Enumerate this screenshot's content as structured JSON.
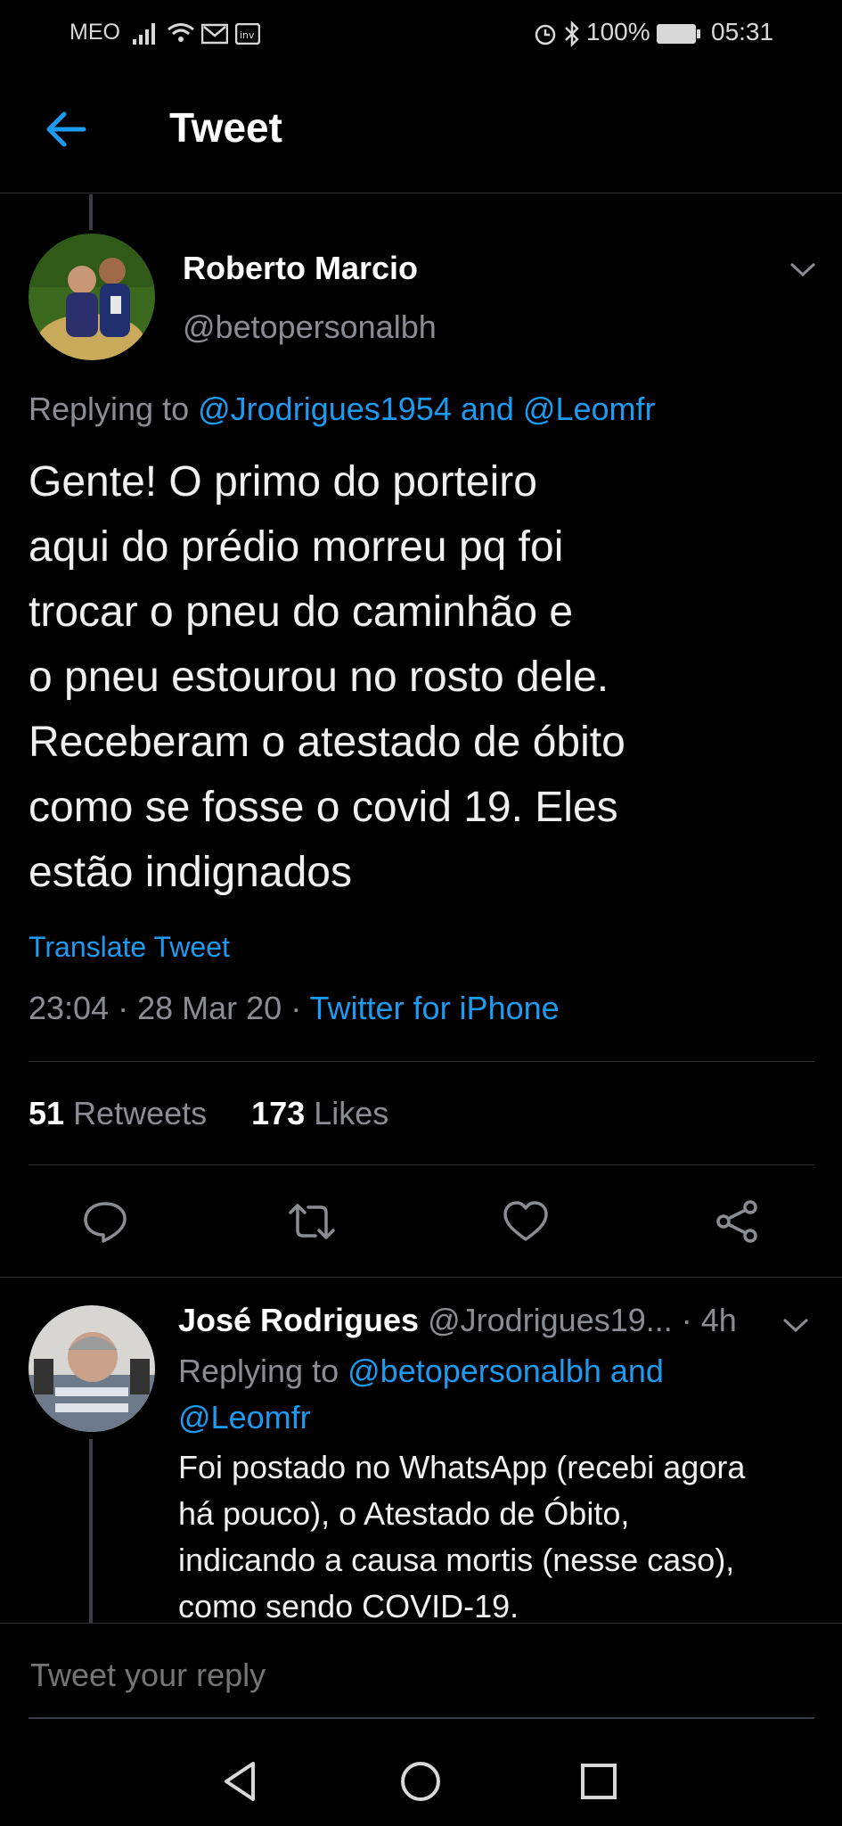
{
  "status_bar": {
    "carrier": "MEO",
    "battery": "100%",
    "time": "05:31"
  },
  "header": {
    "title": "Tweet"
  },
  "tweet": {
    "author_name": "Roberto Marcio",
    "author_handle": "@betopersonalbh",
    "replying_prefix": "Replying to",
    "replying_to": "@Jrodrigues1954 and @Leomfr",
    "text_lines": [
      "Gente! O primo do porteiro",
      "aqui do prédio morreu pq foi",
      "trocar o pneu do caminhão e",
      "o pneu estourou no rosto dele.",
      "Receberam o atestado de óbito",
      "como se fosse o covid 19. Eles",
      "estão indignados"
    ],
    "translate_label": "Translate Tweet",
    "time": "23:04",
    "date": "28 Mar 20",
    "source": "Twitter for iPhone",
    "retweets_count": "51",
    "retweets_label": "Retweets",
    "likes_count": "173",
    "likes_label": "Likes"
  },
  "reply": {
    "author_name": "José Rodrigues",
    "author_handle": "@Jrodrigues19...",
    "age": "· 4h",
    "replying_prefix": "Replying to",
    "replying_to_line1": "@betopersonalbh and",
    "replying_to_line2": "@Leomfr",
    "text_lines": [
      "Foi postado no WhatsApp (recebi agora",
      "há pouco), o Atestado de Óbito,",
      "indicando a causa mortis (nesse caso),",
      "como sendo COVID-19."
    ]
  },
  "composer": {
    "placeholder": "Tweet your reply"
  },
  "colors": {
    "accent": "#1d9bf0",
    "background": "#000000",
    "muted_text": "#8a8d91",
    "divider": "#2f3336"
  },
  "icons": [
    "back-arrow-icon",
    "chevron-down-icon",
    "reply-icon",
    "retweet-icon",
    "like-icon",
    "share-icon",
    "nav-back-icon",
    "nav-home-icon",
    "nav-recents-icon"
  ]
}
